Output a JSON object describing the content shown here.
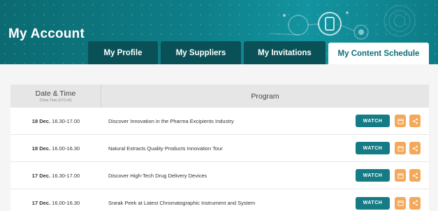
{
  "header": {
    "title": "My Account",
    "tabs": [
      {
        "label": "My Profile",
        "active": false
      },
      {
        "label": "My Suppliers",
        "active": false
      },
      {
        "label": "My Invitations",
        "active": false
      },
      {
        "label": "My Content Schedule",
        "active": true
      }
    ]
  },
  "colors": {
    "banner": "#0e7e88",
    "tab_inactive": "#0a5157",
    "watch_button": "#157c86",
    "icon_button": "#f4a95a"
  },
  "table": {
    "headers": {
      "date": "Date & Time",
      "date_sub": "China Time (UTC+8)",
      "program": "Program"
    },
    "rows": [
      {
        "day": "18 Dec.",
        "time": "16.30-17.00",
        "program": "Discover Innovation in the Pharma Excipients Industry",
        "watch_label": "WATCH",
        "calendar_icon": "calendar-icon",
        "share_icon": "share-icon"
      },
      {
        "day": "18 Dec.",
        "time": "16.00-16.30",
        "program": "Natural Extracts Quality Products Innovation Tour",
        "watch_label": "WATCH",
        "calendar_icon": "calendar-icon",
        "share_icon": "share-icon"
      },
      {
        "day": "17 Dec.",
        "time": "16.30-17.00",
        "program": "Discover High-Tech Drug Delivery Devices",
        "watch_label": "WATCH",
        "calendar_icon": "calendar-icon",
        "share_icon": "share-icon"
      },
      {
        "day": "17 Dec.",
        "time": "16.00-16.30",
        "program": "Sneak Peek at Latest Chromatographic Instrument and System",
        "watch_label": "WATCH",
        "calendar_icon": "calendar-icon",
        "share_icon": "share-icon"
      }
    ]
  }
}
